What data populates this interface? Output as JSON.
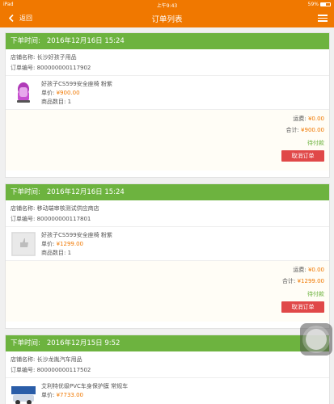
{
  "statusbar": {
    "device": "iPad",
    "time": "上午9:43",
    "battery": "59%"
  },
  "navbar": {
    "back_label": "返回",
    "title": "订单列表"
  },
  "orders": [
    {
      "time_label": "下单时间:",
      "time": "2016年12月16日 15:24",
      "store": "店铺名称:  长沙好孩子用品",
      "order_no": "订单编号:  800000000117902",
      "product_name": "好孩子CS599安全座椅 粉紫",
      "price_label": "单价: ",
      "price": "¥900.00",
      "qty": "商品数目:  1",
      "shipping_label": "运费: ",
      "shipping": "¥0.00",
      "total_label": "合计: ",
      "total": "¥900.00",
      "status": "待付款",
      "cancel_label": "取消订单"
    },
    {
      "time_label": "下单时间:",
      "time": "2016年12月16日 15:24",
      "store": "店铺名称:  移动端审核测试供应商店",
      "order_no": "订单编号:  800000000117801",
      "product_name": "好孩子CS599安全座椅 粉紫",
      "price_label": "单价: ",
      "price": "¥1299.00",
      "qty": "商品数目:  1",
      "shipping_label": "运费: ",
      "shipping": "¥0.00",
      "total_label": "合计: ",
      "total": "¥1299.00",
      "status": "待付款",
      "cancel_label": "取消订单"
    },
    {
      "time_label": "下单时间:",
      "time": "2016年12月15日 9:52",
      "store": "店铺名称:  长沙龙胤汽车用品",
      "order_no": "订单编号:  800000000117502",
      "product_name": "艾利特优级PVC车身保护膜 常规车",
      "price_label": "单价: ",
      "price": "¥7733.00"
    }
  ],
  "colors": {
    "accent": "#f07800",
    "header": "#6db33f",
    "cancel": "#e04848"
  }
}
